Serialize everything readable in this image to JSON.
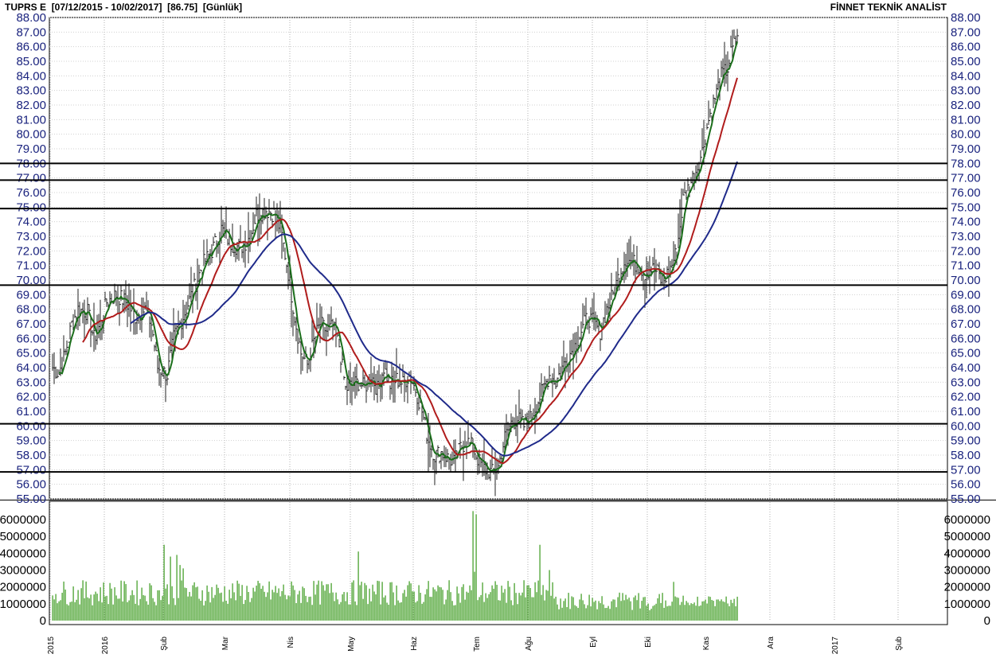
{
  "header": {
    "symbol": "TUPRS E",
    "range": "[07/12/2015 - 10/02/2017]",
    "last": "[86.75]",
    "period": "[Günlük]",
    "brand": "FİNNET TEKNİK ANALİST"
  },
  "chart_data": [
    {
      "type": "candlestick",
      "ylim": [
        55,
        88
      ],
      "y_ticks": [
        "55.00",
        "56.00",
        "57.00",
        "58.00",
        "59.00",
        "60.00",
        "61.00",
        "62.00",
        "63.00",
        "64.00",
        "65.00",
        "66.00",
        "67.00",
        "68.00",
        "69.00",
        "70.00",
        "71.00",
        "72.00",
        "73.00",
        "74.00",
        "75.00",
        "76.00",
        "77.00",
        "78.00",
        "79.00",
        "80.00",
        "81.00",
        "82.00",
        "83.00",
        "84.00",
        "85.00",
        "86.00",
        "87.00",
        "88.00"
      ],
      "x_ticks": [
        "2015",
        "2016",
        "Şub",
        "Mar",
        "Nis",
        "May",
        "Haz",
        "Tem",
        "Ağu",
        "Eyl",
        "Eki",
        "Kas",
        "Ara",
        "2017",
        "Şub"
      ],
      "grid": true,
      "horizontal_levels": [
        78.0,
        76.85,
        74.9,
        69.65,
        60.15,
        56.85
      ],
      "price_path": [
        [
          0,
          64
        ],
        [
          4,
          63.6
        ],
        [
          8,
          65
        ],
        [
          12,
          67
        ],
        [
          16,
          68
        ],
        [
          22,
          67.8
        ],
        [
          26,
          66
        ],
        [
          30,
          67
        ],
        [
          34,
          68.5
        ],
        [
          40,
          69
        ],
        [
          46,
          68.5
        ],
        [
          52,
          67.5
        ],
        [
          58,
          68
        ],
        [
          62,
          67
        ],
        [
          66,
          64
        ],
        [
          72,
          63.5
        ],
        [
          76,
          66
        ],
        [
          82,
          67.5
        ],
        [
          88,
          69.2
        ],
        [
          94,
          71
        ],
        [
          100,
          72
        ],
        [
          106,
          73.5
        ],
        [
          112,
          72.5
        ],
        [
          118,
          72.2
        ],
        [
          124,
          73
        ],
        [
          128,
          74.5
        ],
        [
          134,
          74.8
        ],
        [
          140,
          74.5
        ],
        [
          144,
          73
        ],
        [
          148,
          70.5
        ],
        [
          152,
          67.5
        ],
        [
          156,
          65
        ],
        [
          160,
          64.2
        ],
        [
          164,
          65.8
        ],
        [
          168,
          67
        ],
        [
          172,
          66.5
        ],
        [
          176,
          66.8
        ],
        [
          180,
          65.5
        ],
        [
          184,
          62.5
        ],
        [
          188,
          62.8
        ],
        [
          192,
          63
        ],
        [
          196,
          62.6
        ],
        [
          200,
          63.5
        ],
        [
          204,
          62.5
        ],
        [
          208,
          64
        ],
        [
          212,
          62.8
        ],
        [
          216,
          63.2
        ],
        [
          220,
          62.9
        ],
        [
          224,
          63.5
        ],
        [
          228,
          62.5
        ],
        [
          232,
          61
        ],
        [
          236,
          59
        ],
        [
          240,
          58
        ],
        [
          244,
          58.2
        ],
        [
          248,
          57.8
        ],
        [
          252,
          57.5
        ],
        [
          256,
          58.5
        ],
        [
          260,
          59
        ],
        [
          264,
          58.5
        ],
        [
          268,
          57.5
        ],
        [
          272,
          57
        ],
        [
          276,
          56.8
        ],
        [
          280,
          57.2
        ],
        [
          284,
          59.2
        ],
        [
          288,
          60.2
        ],
        [
          292,
          60.5
        ],
        [
          296,
          60
        ],
        [
          300,
          60.5
        ],
        [
          304,
          61.5
        ],
        [
          308,
          62.5
        ],
        [
          312,
          63.5
        ],
        [
          316,
          63
        ],
        [
          320,
          64
        ],
        [
          324,
          64.8
        ],
        [
          328,
          65.5
        ],
        [
          332,
          66.5
        ],
        [
          336,
          67.5
        ],
        [
          340,
          67
        ],
        [
          344,
          66.5
        ],
        [
          348,
          68
        ],
        [
          352,
          69
        ],
        [
          356,
          70.5
        ],
        [
          360,
          71.5
        ],
        [
          364,
          71.2
        ],
        [
          368,
          71
        ],
        [
          372,
          70.5
        ],
        [
          376,
          70.8
        ],
        [
          380,
          70.5
        ],
        [
          382,
          70
        ],
        [
          384,
          70
        ],
        [
          388,
          70.8
        ],
        [
          392,
          72
        ],
        [
          396,
          75.5
        ],
        [
          400,
          76.5
        ],
        [
          404,
          77.5
        ],
        [
          408,
          78.8
        ],
        [
          412,
          81
        ],
        [
          416,
          82.5
        ],
        [
          420,
          84
        ],
        [
          424,
          84.5
        ],
        [
          426,
          85.5
        ],
        [
          430,
          86.75
        ]
      ],
      "volume_ylim": [
        0,
        6800000
      ],
      "volume_ticks": [
        "0",
        "1000000",
        "2000000",
        "3000000",
        "4000000",
        "5000000",
        "6000000"
      ],
      "volume_color": "#3a9a1c"
    }
  ]
}
